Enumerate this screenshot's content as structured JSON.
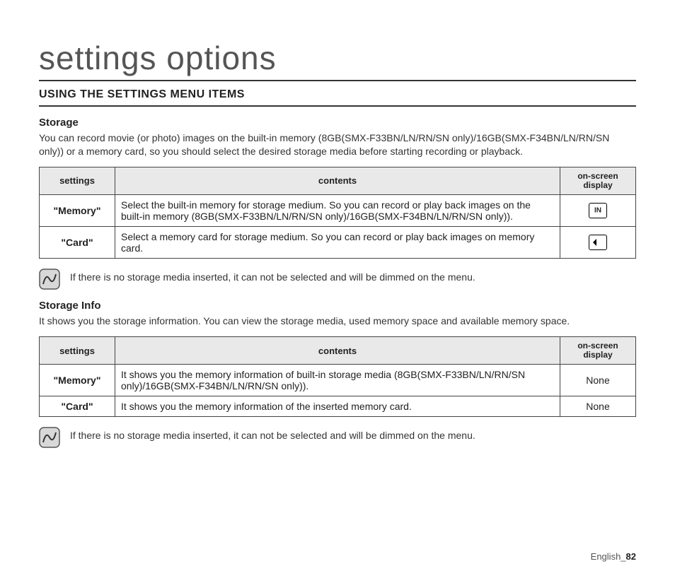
{
  "title": "settings options",
  "section_heading": "USING THE SETTINGS MENU ITEMS",
  "storage": {
    "heading": "Storage",
    "desc": "You can record movie (or photo) images on the built-in memory (8GB(SMX-F33BN/LN/RN/SN only)/16GB(SMX-F34BN/LN/RN/SN only)) or a memory card, so you should select the desired storage media before starting recording or playback.",
    "table_headers": {
      "c1": "settings",
      "c2": "contents",
      "c3": "on-screen display"
    },
    "rows": [
      {
        "setting": "\"Memory\"",
        "content": "Select the built-in memory for storage medium. So you can record or play back images on the built-in memory (8GB(SMX-F33BN/LN/RN/SN only)/16GB(SMX-F34BN/LN/RN/SN only))."
      },
      {
        "setting": "\"Card\"",
        "content": "Select a memory card for storage medium. So you can record or play back images on memory card."
      }
    ],
    "note": "If there is no storage media inserted, it can not be selected and will be dimmed on the menu."
  },
  "storage_info": {
    "heading": "Storage Info",
    "desc": "It shows you the storage information. You can view the storage media, used memory space and available memory space.",
    "table_headers": {
      "c1": "settings",
      "c2": "contents",
      "c3": "on-screen display"
    },
    "rows": [
      {
        "setting": "\"Memory\"",
        "content": "It shows you the memory information of built-in storage media (8GB(SMX-F33BN/LN/RN/SN only)/16GB(SMX-F34BN/LN/RN/SN only)).",
        "display": "None"
      },
      {
        "setting": "\"Card\"",
        "content": "It shows you the memory information of the inserted memory card.",
        "display": "None"
      }
    ],
    "note": "If there is no storage media inserted, it can not be selected and will be dimmed on the menu."
  },
  "footer": {
    "lang": "English",
    "sep": "_",
    "page": "82"
  },
  "icons": {
    "memory_label": "IN"
  }
}
